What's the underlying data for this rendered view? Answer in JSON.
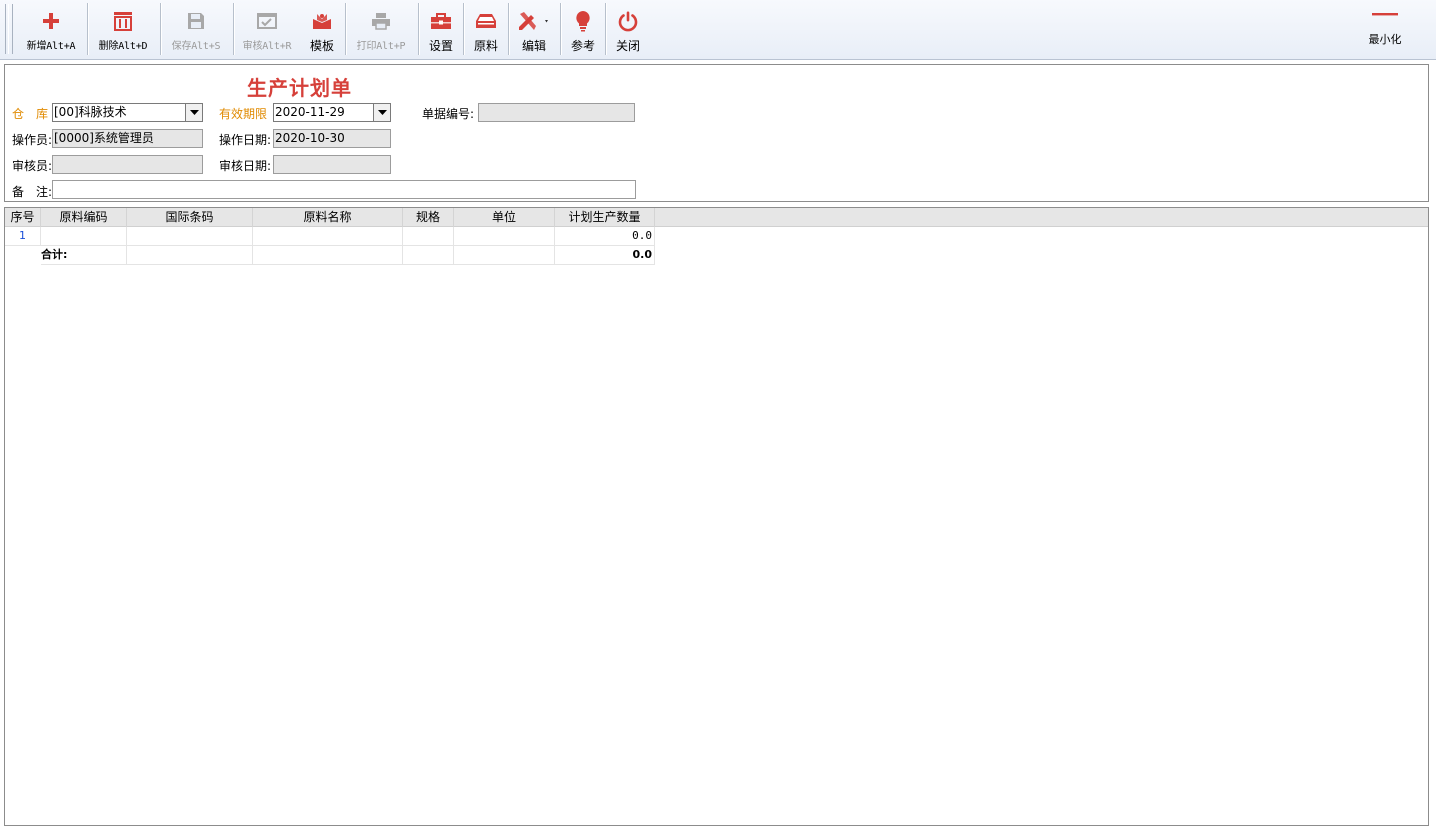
{
  "toolbar": {
    "buttons": [
      {
        "label": "新增Alt+A",
        "icon": "plus-icon",
        "enabled": true
      },
      {
        "label": "删除Alt+D",
        "icon": "trash-icon",
        "enabled": true
      },
      {
        "label": "保存Alt+S",
        "icon": "save-icon",
        "enabled": false
      },
      {
        "label": "审核Alt+R",
        "icon": "approve-icon",
        "enabled": false
      },
      {
        "label": "模板",
        "icon": "template-icon",
        "enabled": true
      },
      {
        "label": "打印Alt+P",
        "icon": "printer-icon",
        "enabled": false
      },
      {
        "label": "设置",
        "icon": "toolbox-icon",
        "enabled": true
      },
      {
        "label": "原料",
        "icon": "tray-icon",
        "enabled": true
      },
      {
        "label": "编辑",
        "icon": "edit-tools-icon",
        "enabled": true
      },
      {
        "label": "参考",
        "icon": "bulb-icon",
        "enabled": true
      },
      {
        "label": "关闭",
        "icon": "power-icon",
        "enabled": true
      }
    ],
    "minimize_label": "最小化",
    "accent_color": "#d6403a",
    "disabled_color": "#9a9a9a"
  },
  "form": {
    "title": "生产计划单",
    "warehouse_label": "仓　库",
    "warehouse_value": "[00]科脉技术",
    "valid_until_label": "有效期限",
    "valid_until_value": "2020-11-29",
    "doc_no_label": "单据编号:",
    "doc_no_value": "",
    "operator_label": "操作员:",
    "operator_value": "[0000]系统管理员",
    "op_date_label": "操作日期:",
    "op_date_value": "2020-10-30",
    "auditor_label": "审核员:",
    "auditor_value": "",
    "audit_date_label": "审核日期:",
    "audit_date_value": "",
    "remark_label": "备　注:",
    "remark_value": ""
  },
  "grid": {
    "columns": [
      "序号",
      "原料编码",
      "国际条码",
      "原料名称",
      "规格",
      "单位",
      "计划生产数量"
    ],
    "rows": [
      {
        "seq": "1",
        "code": "",
        "barcode": "",
        "name": "",
        "spec": "",
        "unit": "",
        "qty": "0.0"
      }
    ],
    "total_label": "合计:",
    "total_qty": "0.0"
  }
}
